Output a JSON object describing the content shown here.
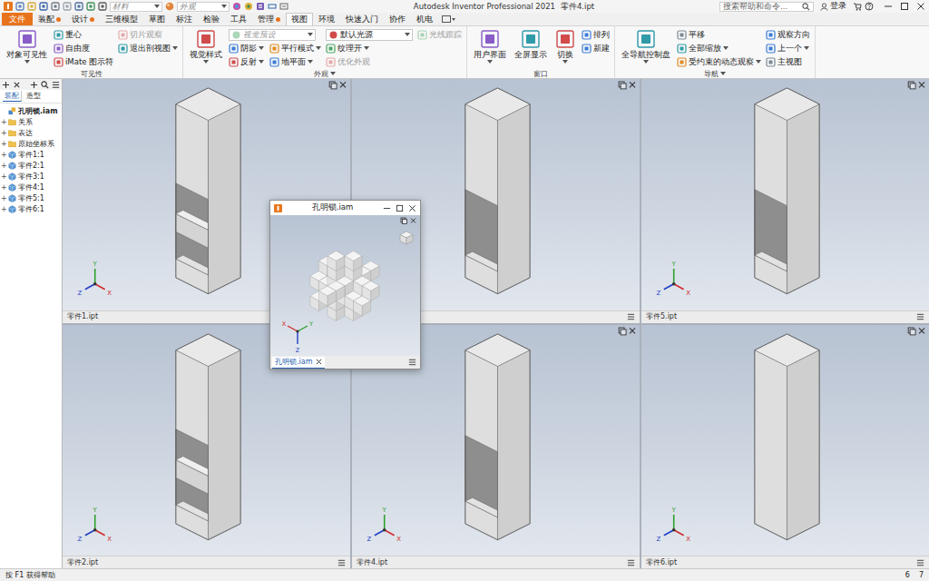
{
  "title_bar": {
    "material_placeholder": "材料",
    "appearance_placeholder": "外观",
    "app_title": "Autodesk Inventor Professional 2021",
    "document": "零件4.ipt",
    "search_placeholder": "搜索帮助和命令...",
    "login": "登录"
  },
  "ribbon_tabs": [
    {
      "label": "文件",
      "kind": "file",
      "selected": false,
      "badge": false
    },
    {
      "label": "装配",
      "kind": "tab",
      "selected": false,
      "badge": true
    },
    {
      "label": "设计",
      "kind": "tab",
      "selected": false,
      "badge": true
    },
    {
      "label": "三维模型",
      "kind": "tab",
      "selected": false,
      "badge": false
    },
    {
      "label": "草图",
      "kind": "tab",
      "selected": false,
      "badge": false
    },
    {
      "label": "标注",
      "kind": "tab",
      "selected": false,
      "badge": false
    },
    {
      "label": "检验",
      "kind": "tab",
      "selected": false,
      "badge": false
    },
    {
      "label": "工具",
      "kind": "tab",
      "selected": false,
      "badge": false
    },
    {
      "label": "管理",
      "kind": "tab",
      "selected": false,
      "badge": true
    },
    {
      "label": "视图",
      "kind": "tab",
      "selected": true,
      "badge": false
    },
    {
      "label": "环境",
      "kind": "tab",
      "selected": false,
      "badge": false
    },
    {
      "label": "快速入门",
      "kind": "tab",
      "selected": false,
      "badge": false
    },
    {
      "label": "协作",
      "kind": "tab",
      "selected": false,
      "badge": false
    },
    {
      "label": "机电",
      "kind": "tab",
      "selected": false,
      "badge": false
    }
  ],
  "ribbon_groups": [
    {
      "label": "可见性",
      "dropdown": false,
      "columns": [
        {
          "kind": "large",
          "rows": [
            [
              {
                "kind": "button",
                "label": "对象可见性",
                "disabled": false,
                "dropdown": true
              }
            ]
          ]
        },
        {
          "kind": "stack",
          "rows": [
            [
              {
                "kind": "button",
                "label": "重心",
                "disabled": false,
                "dropdown": false
              }
            ],
            [
              {
                "kind": "button",
                "label": "自由度",
                "disabled": false,
                "dropdown": false
              }
            ],
            [
              {
                "kind": "button",
                "label": "iMate 图示符",
                "disabled": false,
                "dropdown": false
              }
            ]
          ]
        },
        {
          "kind": "stack",
          "rows": [
            [
              {
                "kind": "button",
                "label": "切片观察",
                "disabled": true,
                "dropdown": false
              }
            ],
            [
              {
                "kind": "button",
                "label": "退出剖视图",
                "disabled": false,
                "dropdown": true
              }
            ]
          ]
        }
      ]
    },
    {
      "label": "外观",
      "dropdown": true,
      "columns": [
        {
          "kind": "large",
          "rows": [
            [
              {
                "kind": "button",
                "label": "视觉样式",
                "disabled": false,
                "dropdown": true
              }
            ]
          ]
        },
        {
          "kind": "stack",
          "rows": [
            [
              {
                "kind": "select",
                "label": "视觉预设",
                "disabled": true,
                "dropdown": true
              }
            ],
            [
              {
                "kind": "button",
                "label": "阴影",
                "disabled": false,
                "dropdown": true
              },
              {
                "kind": "button",
                "label": "平行模式",
                "disabled": false,
                "dropdown": true
              }
            ],
            [
              {
                "kind": "button",
                "label": "反射",
                "disabled": false,
                "dropdown": true
              },
              {
                "kind": "button",
                "label": "地平面",
                "disabled": false,
                "dropdown": true
              }
            ]
          ]
        },
        {
          "kind": "stack",
          "rows": [
            [
              {
                "kind": "select",
                "label": "默认光源",
                "disabled": false,
                "dropdown": true
              }
            ],
            [
              {
                "kind": "button",
                "label": "纹理开",
                "disabled": false,
                "dropdown": true
              }
            ],
            [
              {
                "kind": "button",
                "label": "优化外观",
                "disabled": true,
                "dropdown": false
              }
            ]
          ]
        },
        {
          "kind": "stack",
          "rows": [
            [
              {
                "kind": "button",
                "label": "光线跟踪",
                "disabled": true,
                "dropdown": false
              }
            ]
          ]
        }
      ]
    },
    {
      "label": "窗口",
      "dropdown": false,
      "columns": [
        {
          "kind": "large",
          "rows": [
            [
              {
                "kind": "button",
                "label": "用户界面",
                "disabled": false,
                "dropdown": true
              }
            ]
          ]
        },
        {
          "kind": "large",
          "rows": [
            [
              {
                "kind": "button",
                "label": "全屏显示",
                "disabled": false,
                "dropdown": false
              }
            ]
          ]
        },
        {
          "kind": "large",
          "rows": [
            [
              {
                "kind": "button",
                "label": "切换",
                "disabled": false,
                "dropdown": true
              }
            ]
          ]
        },
        {
          "kind": "stack",
          "rows": [
            [
              {
                "kind": "button",
                "label": "排列",
                "disabled": false,
                "dropdown": false
              }
            ],
            [
              {
                "kind": "button",
                "label": "新建",
                "disabled": false,
                "dropdown": false
              }
            ]
          ]
        }
      ]
    },
    {
      "label": "导航",
      "dropdown": true,
      "columns": [
        {
          "kind": "large",
          "rows": [
            [
              {
                "kind": "button",
                "label": "全导航控制盘",
                "disabled": false,
                "dropdown": true
              }
            ]
          ]
        },
        {
          "kind": "stack",
          "rows": [
            [
              {
                "kind": "button",
                "label": "平移",
                "disabled": false,
                "dropdown": false
              }
            ],
            [
              {
                "kind": "button",
                "label": "全部缩放",
                "disabled": false,
                "dropdown": true
              }
            ],
            [
              {
                "kind": "button",
                "label": "受约束的动态观察",
                "disabled": false,
                "dropdown": true
              }
            ]
          ]
        },
        {
          "kind": "stack",
          "rows": [
            [
              {
                "kind": "button",
                "label": "观察方向",
                "disabled": false,
                "dropdown": false
              }
            ],
            [
              {
                "kind": "button",
                "label": "上一个",
                "disabled": false,
                "dropdown": true
              }
            ],
            [
              {
                "kind": "button",
                "label": "主视图",
                "disabled": false,
                "dropdown": false
              }
            ]
          ]
        }
      ]
    }
  ],
  "browser": {
    "tabs": [
      {
        "label": "装配",
        "selected": true
      },
      {
        "label": "造型",
        "selected": false
      }
    ],
    "tree": [
      {
        "label": "孔明锁.iam",
        "expander": "",
        "kind": "assembly",
        "bold": true
      },
      {
        "label": "关系",
        "expander": "+",
        "kind": "folder",
        "bold": false
      },
      {
        "label": "表达",
        "expander": "+",
        "kind": "folder",
        "bold": false
      },
      {
        "label": "原始坐标系",
        "expander": "+",
        "kind": "folder",
        "bold": false
      },
      {
        "label": "零件1:1",
        "expander": "+",
        "kind": "part",
        "bold": false
      },
      {
        "label": "零件2:1",
        "expander": "+",
        "kind": "part",
        "bold": false
      },
      {
        "label": "零件3:1",
        "expander": "+",
        "kind": "part",
        "bold": false
      },
      {
        "label": "零件4:1",
        "expander": "+",
        "kind": "part",
        "bold": false
      },
      {
        "label": "零件5:1",
        "expander": "+",
        "kind": "part",
        "bold": false
      },
      {
        "label": "零件6:1",
        "expander": "+",
        "kind": "part",
        "bold": false
      }
    ]
  },
  "viewports": [
    {
      "label": "零件1.ipt",
      "kind": "slot-bridge"
    },
    {
      "label": "",
      "kind": "slot"
    },
    {
      "label": "零件5.ipt",
      "kind": "slot"
    },
    {
      "label": "零件2.ipt",
      "kind": "slot-bridge"
    },
    {
      "label": "零件4.ipt",
      "kind": "slot"
    },
    {
      "label": "零件6.ipt",
      "kind": "plain"
    }
  ],
  "axes": {
    "x": "X",
    "y": "Y",
    "z": "Z"
  },
  "assembly_window": {
    "title": "孔明锁.iam",
    "tab": "孔明锁.iam",
    "tab_selected": true
  },
  "status_bar": {
    "help": "按 F1 获得帮助",
    "pages": [
      "6",
      "7"
    ]
  }
}
